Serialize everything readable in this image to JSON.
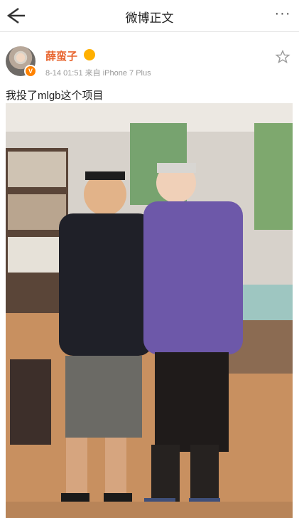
{
  "header": {
    "title": "微博正文",
    "back_icon": "arrow-left-icon",
    "more_icon": "more-dots-icon"
  },
  "post": {
    "author": "薛蛮子",
    "time": "8-14 01:51",
    "source": "来自 iPhone 7 Plus",
    "text": "我投了mlgb这个项目",
    "image_description": "Two men standing together indoors",
    "colors": {
      "name": "#e8652f",
      "badge": "#ff8200"
    }
  }
}
